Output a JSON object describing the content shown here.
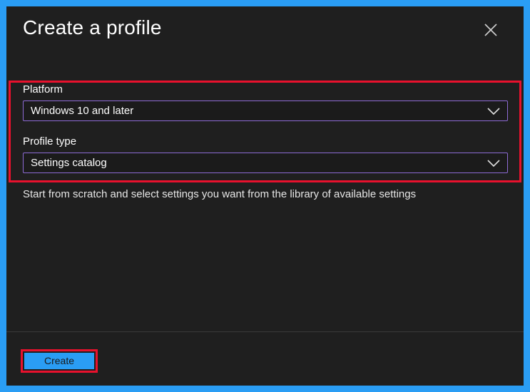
{
  "dialog": {
    "title": "Create a profile",
    "close_icon": "close-icon"
  },
  "platform": {
    "label": "Platform",
    "value": "Windows 10 and later",
    "icon": "chevron-down-icon"
  },
  "profile_type": {
    "label": "Profile type",
    "value": "Settings catalog",
    "icon": "chevron-down-icon"
  },
  "description": "Start from scratch and select settings you want from the library of available settings",
  "footer": {
    "create_label": "Create"
  },
  "colors": {
    "background_frame": "#2a9df4",
    "dialog_bg": "#1f1f1f",
    "highlight": "#e8112d",
    "select_border": "#8e6bd6",
    "primary_button": "#2a9df4"
  }
}
